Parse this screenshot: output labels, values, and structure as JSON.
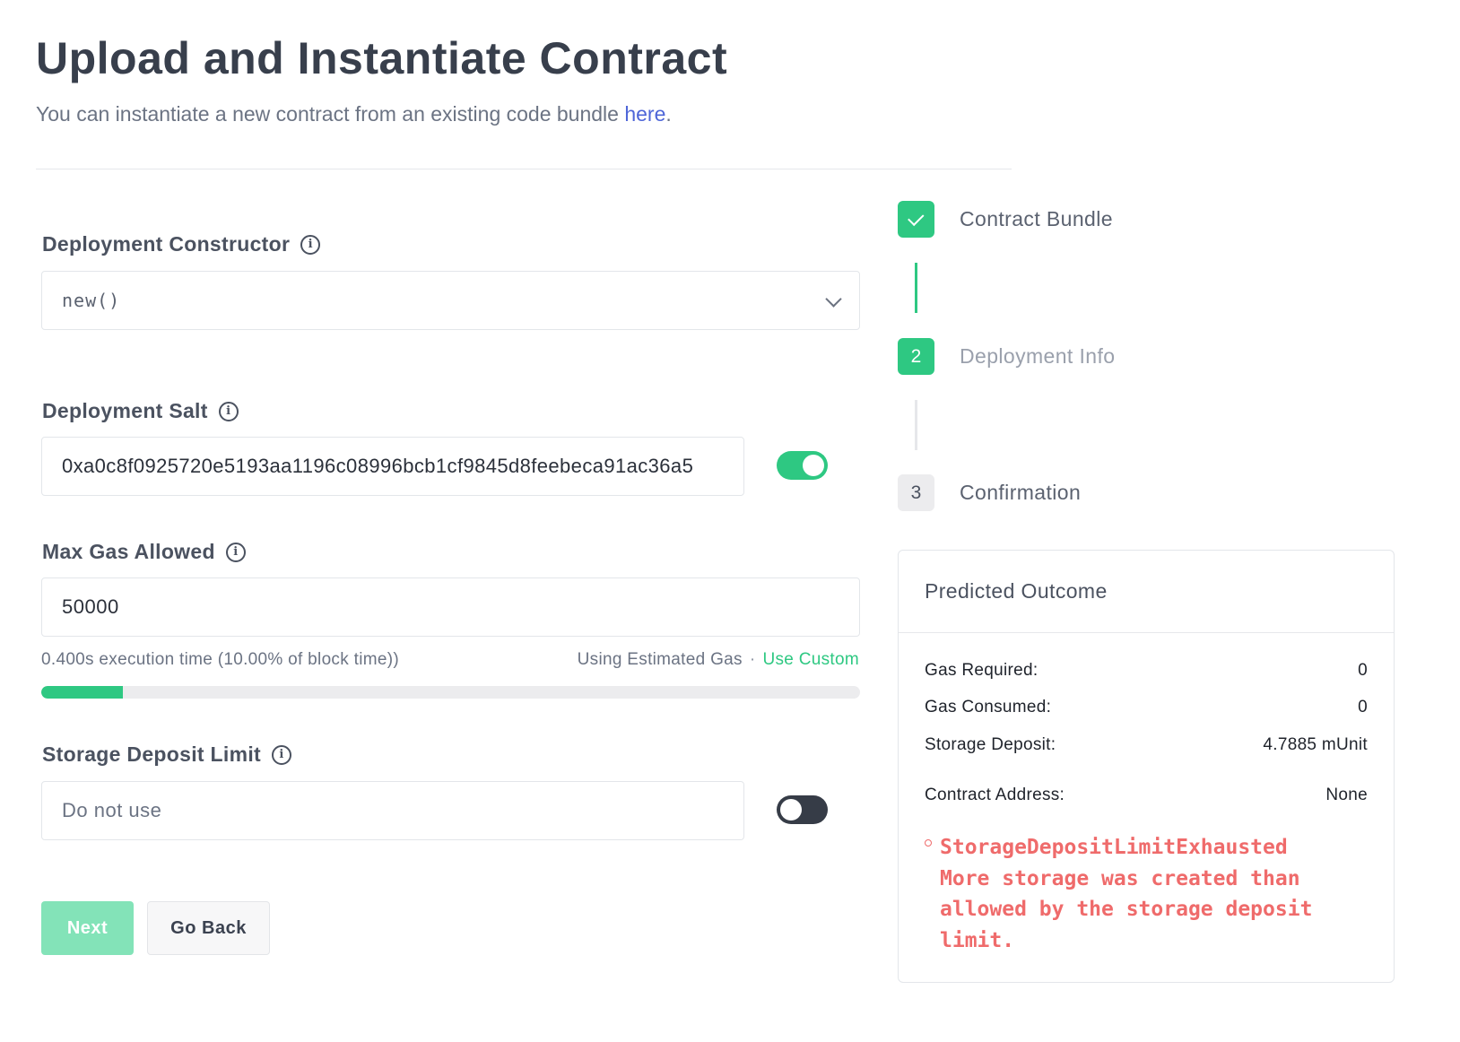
{
  "header": {
    "title": "Upload and Instantiate Contract",
    "subtitle": "You can instantiate a new contract from an existing code bundle",
    "subtitle_link": "here",
    "subtitle_end": "."
  },
  "form": {
    "constructor": {
      "label": "Deployment Constructor",
      "value": "new()"
    },
    "salt": {
      "label": "Deployment Salt",
      "value": "0xa0c8f0925720e5193aa1196c08996bcb1cf9845d8feebeca91ac36a5",
      "toggle_on": true
    },
    "gas": {
      "label": "Max Gas Allowed",
      "value": "50000",
      "hint": "0.400s execution time (10.00% of block time))",
      "mode": "Using Estimated Gas",
      "separator": "·",
      "custom_link": "Use Custom",
      "progress_fraction": 0.1
    },
    "storage": {
      "label": "Storage Deposit Limit",
      "placeholder": "Do not use",
      "toggle_on": false
    },
    "buttons": {
      "next": "Next",
      "back": "Go Back"
    }
  },
  "stepper": {
    "steps": [
      {
        "label": "Contract Bundle",
        "state": "done"
      },
      {
        "label": "Deployment Info",
        "state": "active",
        "number": "2"
      },
      {
        "label": "Confirmation",
        "state": "todo",
        "number": "3"
      }
    ]
  },
  "outcome": {
    "title": "Predicted Outcome",
    "rows": [
      {
        "label": "Gas Required:",
        "value": "0"
      },
      {
        "label": "Gas Consumed:",
        "value": "0"
      },
      {
        "label": "Storage Deposit:",
        "value": "4.7885 mUnit"
      },
      {
        "label": "Contract Address:",
        "value": "None"
      }
    ],
    "error_name": "StorageDepositLimitExhausted",
    "error_message": "More storage was created than allowed by the storage deposit limit."
  },
  "colors": {
    "accent": "#2ec882",
    "link": "#4e66d8",
    "error": "#ef6b6b"
  }
}
